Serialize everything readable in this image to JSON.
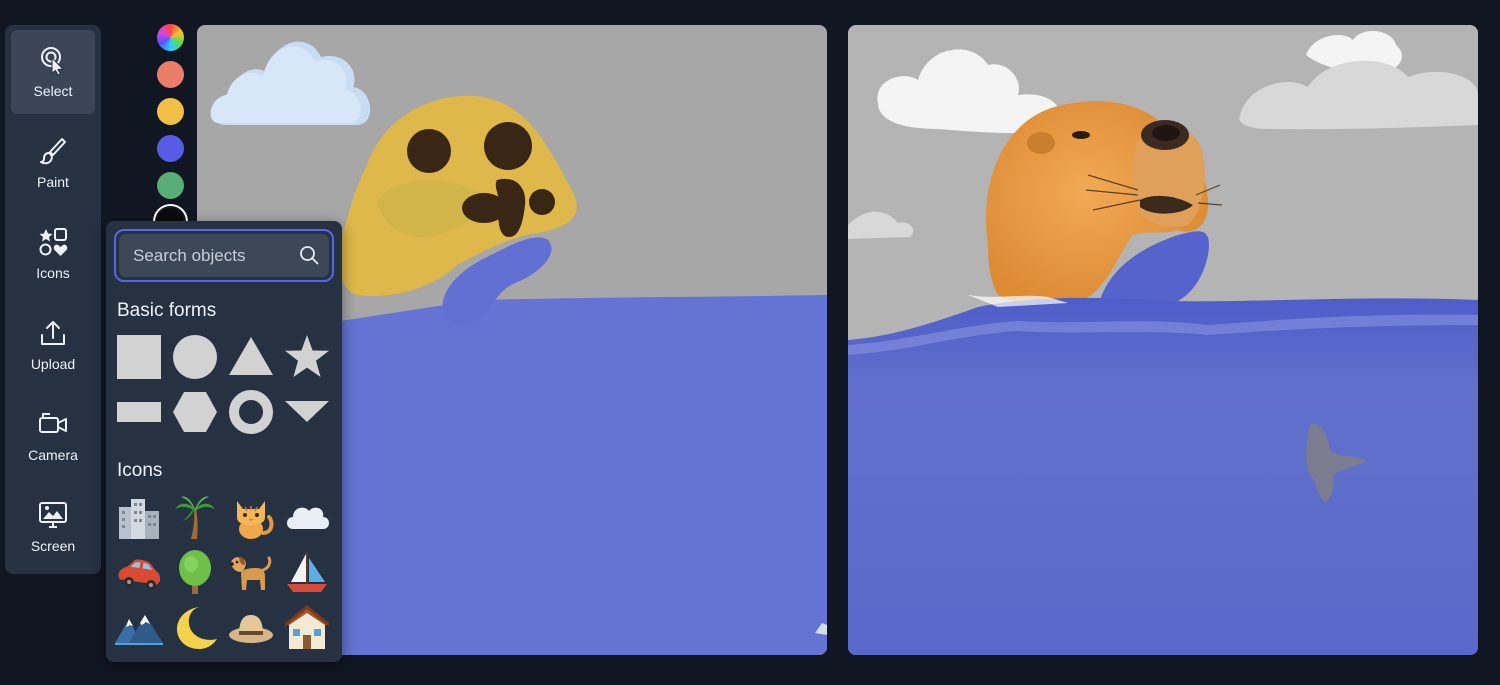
{
  "toolbar": {
    "items": [
      {
        "label": "Select",
        "icon": "pointer-click-icon",
        "active": true
      },
      {
        "label": "Paint",
        "icon": "paintbrush-icon",
        "active": false
      },
      {
        "label": "Icons",
        "icon": "shapes-icon",
        "active": false
      },
      {
        "label": "Upload",
        "icon": "upload-icon",
        "active": false
      },
      {
        "label": "Camera",
        "icon": "video-camera-icon",
        "active": false
      },
      {
        "label": "Screen",
        "icon": "screen-share-icon",
        "active": false
      }
    ]
  },
  "palette": {
    "swatches": [
      {
        "name": "rainbow",
        "color": "conic"
      },
      {
        "name": "coral",
        "color": "#e97d6a"
      },
      {
        "name": "yellow",
        "color": "#f2bf45"
      },
      {
        "name": "blue",
        "color": "#565de4"
      },
      {
        "name": "green",
        "color": "#57ad73"
      },
      {
        "name": "black",
        "color": "#0b0b0b",
        "selected": true
      }
    ]
  },
  "objects_panel": {
    "search": {
      "placeholder": "Search objects",
      "value": ""
    },
    "basic_forms_title": "Basic forms",
    "basic_forms": [
      "square",
      "circle",
      "triangle",
      "star",
      "rectangle",
      "hexagon",
      "ring",
      "inverted-triangle"
    ],
    "icons_title": "Icons",
    "icons": [
      "city-buildings",
      "palm-tree",
      "cat",
      "cloud",
      "car",
      "tree",
      "dog",
      "sailboat",
      "mountains",
      "crescent-moon",
      "hat",
      "house"
    ]
  },
  "colors": {
    "background": "#111722",
    "panel": "#263142",
    "accent": "#5b63e8",
    "sky_gray": "#a7a7a7",
    "water_blue": "#6573d4"
  }
}
